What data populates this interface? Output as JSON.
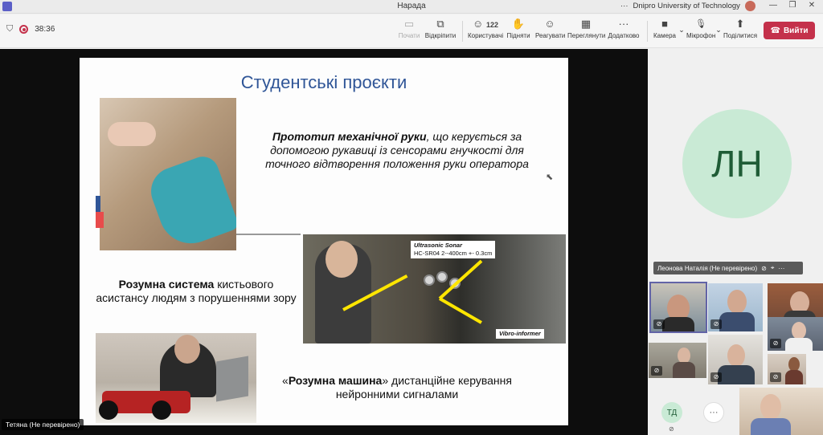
{
  "window": {
    "title": "Нарада",
    "organization": "Dnipro University of Technology",
    "more": "···",
    "minimize": "—",
    "maximize": "❐",
    "close": "✕"
  },
  "meeting": {
    "timer": "38:36",
    "leave_label": "Вийти",
    "toolbar": [
      {
        "id": "start",
        "label": "Почати",
        "icon": "record-icon",
        "glyph": "▭",
        "disabled": true
      },
      {
        "id": "popout",
        "label": "Відкріпити",
        "icon": "popout-icon",
        "glyph": "⧉",
        "disabled": false
      },
      {
        "id": "people",
        "label": "Користувачі",
        "icon": "people-icon",
        "glyph": "☺",
        "count": "122",
        "disabled": false
      },
      {
        "id": "raise",
        "label": "Підняти",
        "icon": "raise-hand-icon",
        "glyph": "✋",
        "disabled": false
      },
      {
        "id": "react",
        "label": "Реагувати",
        "icon": "react-icon",
        "glyph": "☺",
        "disabled": false
      },
      {
        "id": "view",
        "label": "Переглянути",
        "icon": "view-grid-icon",
        "glyph": "▦",
        "disabled": false
      },
      {
        "id": "more",
        "label": "Додатково",
        "icon": "more-icon",
        "glyph": "···",
        "disabled": false
      },
      {
        "id": "camera",
        "label": "Камера",
        "icon": "camera-icon",
        "glyph": "■",
        "disabled": false
      },
      {
        "id": "mic",
        "label": "Мікрофон",
        "icon": "mic-off-icon",
        "glyph": "🎙",
        "disabled": false
      },
      {
        "id": "share",
        "label": "Поділитися",
        "icon": "share-icon",
        "glyph": "⬆",
        "disabled": false
      }
    ]
  },
  "slide": {
    "title": "Студентські проєкти",
    "text1_bold": "Прототип механічної руки",
    "text1_rest": ", що керується за допомогою рукавиці із сенсорами гнучкості для точного відтворення положення руки оператора",
    "text2_bold": "Розумна система",
    "text2_rest": " кистьового асистансу людям з порушеннями зору",
    "text3_open": "«",
    "text3_bold": "Розумна машина",
    "text3_rest": "» дистанційне керування нейронними сигналами",
    "sonar_label_1": "Ultrasonic Sonar",
    "sonar_label_2": "HC-SR04 2--400cm +- 0.3cm",
    "vibro_label": "Vibro-informer"
  },
  "presenter": {
    "name_tag": "Тетяна (Не перевірено)"
  },
  "participants": {
    "spotlight_initials": "ЛН",
    "spotlight_name": "Леонова Наталія (Не перевірено)",
    "spotlight_more": "···",
    "small_initials": "ТД",
    "overflow": "···"
  },
  "colors": {
    "accent": "#5b5fc7",
    "leave": "#c4314b",
    "slide_title": "#2f5597",
    "avatar_bg": "#c9ead5"
  }
}
